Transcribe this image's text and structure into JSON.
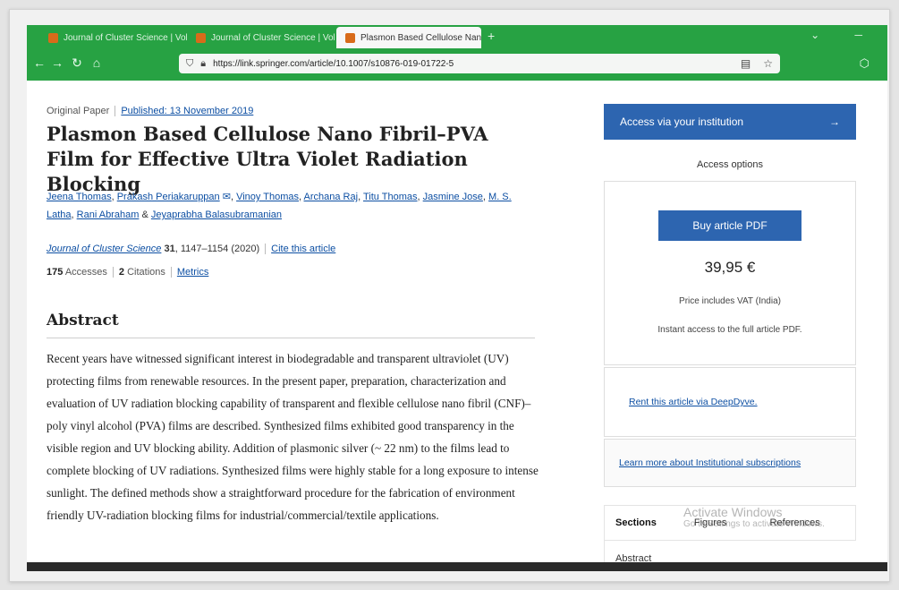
{
  "browser": {
    "tabs": [
      {
        "label": "Journal of Cluster Science | Vol...",
        "active": false
      },
      {
        "label": "Journal of Cluster Science | Vol...",
        "active": false
      },
      {
        "label": "Plasmon Based Cellulose Nan...",
        "active": true
      }
    ],
    "url": "https://link.springer.com/article/10.1007/s10876-019-01722-5"
  },
  "article": {
    "type": "Original Paper",
    "published": "Published: 13 November 2019",
    "title": "Plasmon Based Cellulose Nano Fibril–PVA Film for Effective Ultra Violet Radiation Blocking",
    "authors": [
      "Jeena Thomas",
      "Prakash Periakaruppan",
      "Vinoy Thomas",
      "Archana Raj",
      "Titu Thomas",
      "Jasmine Jose",
      "M. S. Latha",
      "Rani Abraham",
      "Jeyaprabha Balasubramanian"
    ],
    "amp": "&",
    "journal_name": "Journal of Cluster Science",
    "volume": "31",
    "pages": ", 1147–1154 (2020)",
    "cite": "Cite this article",
    "accesses_count": "175",
    "accesses_label": "Accesses",
    "citations_count": "2",
    "citations_label": "Citations",
    "metrics": "Metrics",
    "abstract_heading": "Abstract",
    "abstract_text": "Recent years have witnessed significant interest in biodegradable and transparent ultraviolet (UV) protecting films from renewable resources. In the present paper, preparation, characterization and evaluation of UV radiation blocking capability of transparent and flexible cellulose nano fibril (CNF)–poly vinyl alcohol (PVA) films are described. Synthesized films exhibited good transparency in the visible region and UV blocking ability. Addition of plasmonic silver (~ 22 nm) to the films lead to complete blocking of UV radiations. Synthesized films were highly stable for a long exposure to intense sunlight. The defined methods show a straightforward procedure for the fabrication of environment friendly UV-radiation blocking films for industrial/commercial/textile applications."
  },
  "sidebar": {
    "institution_button": "Access via your institution",
    "institution_arrow": "→",
    "access_options": "Access options",
    "buy_button": "Buy article PDF",
    "price": "39,95 €",
    "vat": "Price includes VAT (India)",
    "instant": "Instant access to the full article PDF.",
    "rent": "Rent this article via DeepDyve.",
    "learn": "Learn more about Institutional subscriptions",
    "sections_tabs": [
      "Sections",
      "Figures",
      "References"
    ],
    "sections_first": "Abstract"
  },
  "watermark": {
    "line1": "Activate Windows",
    "line2": "Go to Settings to activate Windows."
  },
  "colors": {
    "browser_accent": "#27a243",
    "link": "#0d4fa3",
    "button": "#2d65b0"
  }
}
